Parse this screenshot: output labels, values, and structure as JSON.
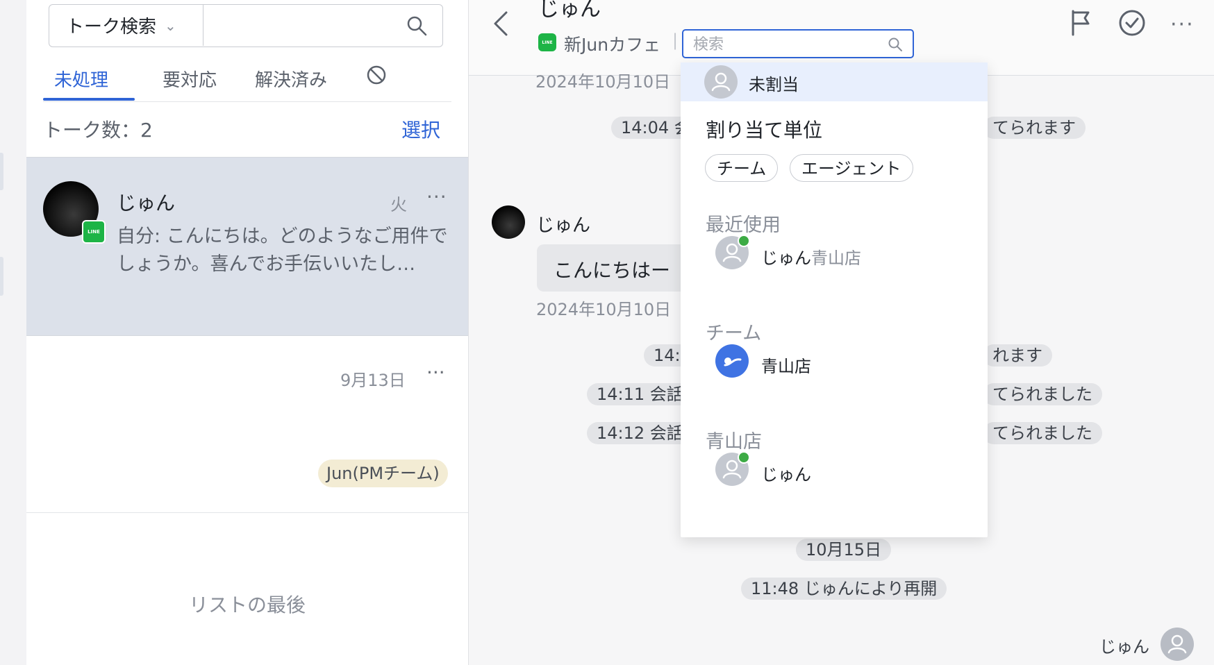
{
  "sidebar": {
    "search_type": "トーク検索",
    "tabs": [
      "未処理",
      "要対応",
      "解決済み"
    ],
    "count_label": "トーク数：2",
    "select_label": "選択",
    "conversations": [
      {
        "name": "じゅん",
        "day": "火",
        "preview": "自分: こんにちは。どのようなご用件でしょうか。喜んでお手伝いいたし…",
        "more": "···",
        "channel_badge": "LINE"
      },
      {
        "date": "9月13日",
        "more": "···",
        "tag": "Jun(PMチーム)"
      }
    ],
    "end_of_list": "リストの最後"
  },
  "chat": {
    "title": "じゅん",
    "channel_name": "新Junカフェ",
    "separator": "|",
    "search_placeholder": "検索",
    "more": "···",
    "messages": {
      "date_top": "2024年10月10日",
      "sys1": "14:04 会",
      "sys1_tail": "てられます",
      "user_name": "じゅん",
      "bubble": "こんにちはー",
      "bubble_time": "2024年10月10日",
      "sys2": "14:0",
      "sys2_tail": "れます",
      "sys3": "14:11 会話",
      "sys3_tail": "てられました",
      "sys4": "14:12 会話",
      "sys4_tail": "てられました",
      "date_mid": "10月15日",
      "sys5": "11:48 じゅんにより再開",
      "agent_name": "じゅん"
    }
  },
  "dropdown": {
    "unassigned": "未割当",
    "assign_unit_title": "割り当て単位",
    "pill_team": "チーム",
    "pill_agent": "エージェント",
    "recent_title": "最近使用",
    "recent_item_name": "じゅん",
    "recent_item_group": "青山店",
    "team_title": "チーム",
    "team_item": "青山店",
    "group_title": "青山店",
    "group_item": "じゅん"
  },
  "colors": {
    "accent": "#2f64d6",
    "line_green": "#1db446",
    "online": "#3dab45",
    "selected_row": "#dce1ea"
  }
}
